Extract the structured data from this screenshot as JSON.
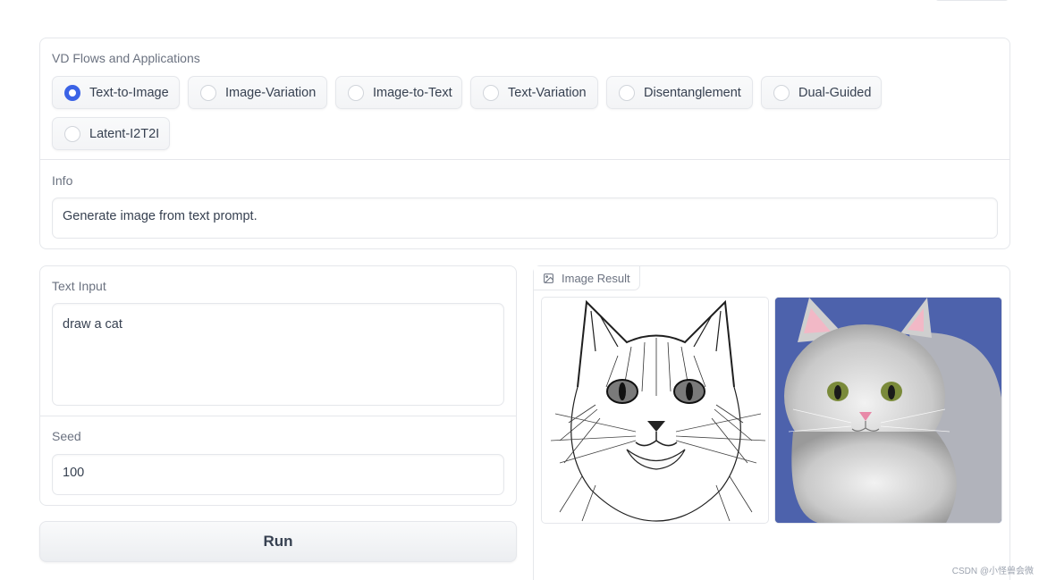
{
  "flows": {
    "label": "VD Flows and Applications",
    "options": [
      {
        "label": "Text-to-Image",
        "selected": true
      },
      {
        "label": "Image-Variation",
        "selected": false
      },
      {
        "label": "Image-to-Text",
        "selected": false
      },
      {
        "label": "Text-Variation",
        "selected": false
      },
      {
        "label": "Disentanglement",
        "selected": false
      },
      {
        "label": "Dual-Guided",
        "selected": false
      },
      {
        "label": "Latent-I2T2I",
        "selected": false
      }
    ]
  },
  "info": {
    "label": "Info",
    "value": "Generate image from text prompt."
  },
  "text_input": {
    "label": "Text Input",
    "value": "draw a cat"
  },
  "seed": {
    "label": "Seed",
    "value": "100"
  },
  "run_label": "Run",
  "image_result": {
    "label": "Image Result",
    "icon": "image-icon"
  },
  "watermark": "CSDN @小怪兽会微",
  "colors": {
    "accent": "#3b63e6",
    "border": "#e5e7eb"
  }
}
